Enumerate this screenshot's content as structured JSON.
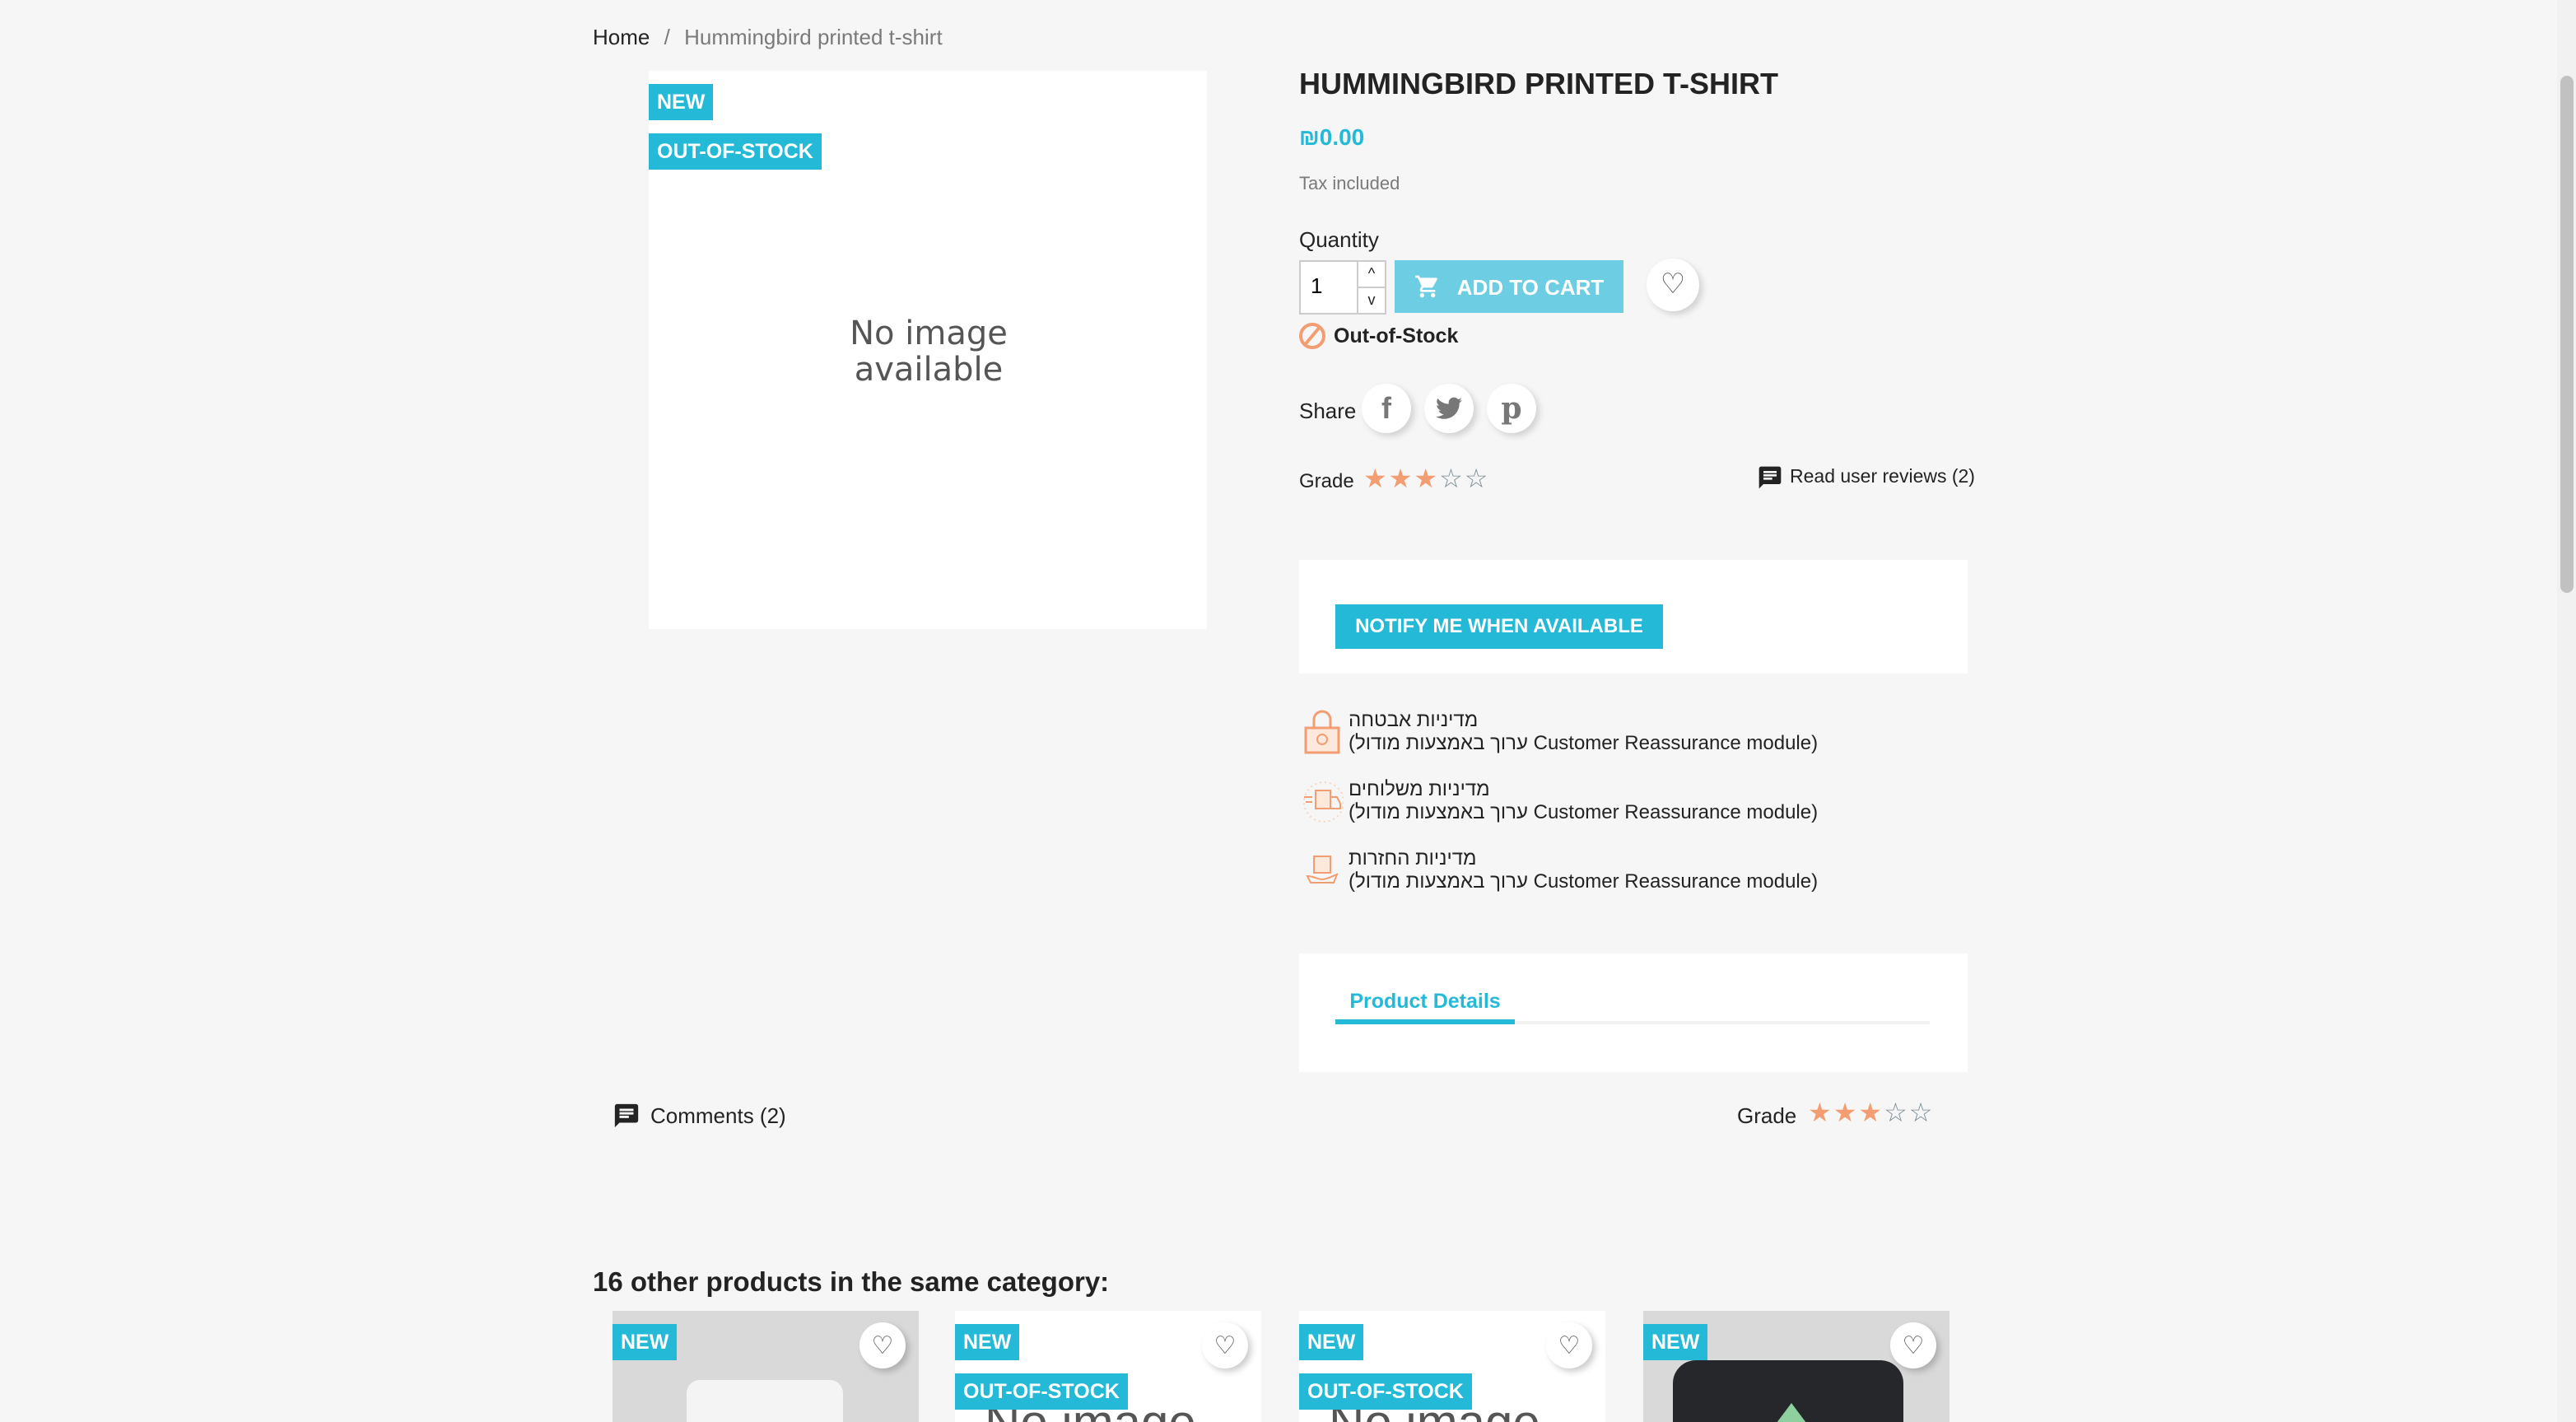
{
  "breadcrumb": {
    "home": "Home",
    "separator": "/",
    "current": "Hummingbird printed t-shirt"
  },
  "image": {
    "no_image": "No image available",
    "badges": [
      "NEW",
      "OUT-OF-STOCK"
    ]
  },
  "product": {
    "title": "HUMMINGBIRD PRINTED T-SHIRT",
    "price": "₪0.00",
    "tax": "Tax included",
    "quantity_label": "Quantity",
    "quantity_value": "1",
    "add_to_cart": "ADD TO CART",
    "stock_status": "Out-of-Stock",
    "share_label": "Share",
    "grade_label": "Grade",
    "rating": 3,
    "rating_max": 5,
    "reviews_link": "Read user reviews (2)"
  },
  "notify": {
    "button": "NOTIFY ME WHEN AVAILABLE"
  },
  "reassurance": [
    {
      "icon": "lock-icon",
      "title": "מדיניות אבטחה",
      "text": "(ערוך באמצעות מודול Customer Reassurance module)"
    },
    {
      "icon": "truck-icon",
      "title": "מדיניות משלוחים",
      "text": "(ערוך באמצעות מודול Customer Reassurance module)"
    },
    {
      "icon": "return-box-icon",
      "title": "מדיניות החזרות",
      "text": "(ערוך באמצעות מודול Customer Reassurance module)"
    }
  ],
  "tabs": {
    "product_details": "Product Details"
  },
  "comments": {
    "label": "Comments (2)",
    "grade_label": "Grade",
    "rating": 3
  },
  "related": {
    "title": "16 other products in the same category:",
    "cards": [
      {
        "badges": [
          "NEW"
        ],
        "image": "mug"
      },
      {
        "badges": [
          "NEW",
          "OUT-OF-STOCK"
        ],
        "image": "No image"
      },
      {
        "badges": [
          "NEW",
          "OUT-OF-STOCK"
        ],
        "image": "No image"
      },
      {
        "badges": [
          "NEW"
        ],
        "image": "pillow"
      }
    ]
  },
  "colors": {
    "accent": "#24b9d7",
    "star": "#f39d72",
    "cart_disabled": "#6dcde2"
  }
}
